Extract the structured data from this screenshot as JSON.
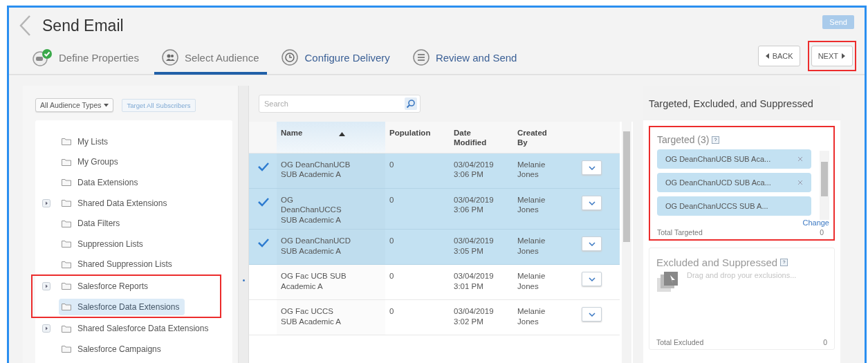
{
  "header": {
    "title": "Send Email",
    "send_button": {
      "label": "Send",
      "disabled": true
    }
  },
  "steps": [
    {
      "label": "Define Properties",
      "selected": false
    },
    {
      "label": "Select Audience",
      "selected": true
    },
    {
      "label": "Configure Delivery",
      "selected": false
    },
    {
      "label": "Review and Send",
      "selected": false
    }
  ],
  "nav_buttons": [
    {
      "label": "BACK",
      "kind": "back",
      "highlighted": false
    },
    {
      "label": "NEXT",
      "kind": "next",
      "highlighted": true
    }
  ],
  "sidebar": {
    "filter": "All Audience Types",
    "target_all": {
      "label": "Target All Subscribers",
      "disabled": true
    },
    "items": [
      {
        "label": "My Lists",
        "expandable": false,
        "selected": false,
        "highlighted": false
      },
      {
        "label": "My Groups",
        "expandable": false,
        "selected": false,
        "highlighted": false
      },
      {
        "label": "Data Extensions",
        "expandable": false,
        "selected": false,
        "highlighted": false
      },
      {
        "label": "Shared Data Extensions",
        "expandable": true,
        "selected": false,
        "highlighted": false
      },
      {
        "label": "Data Filters",
        "expandable": false,
        "selected": false,
        "highlighted": false
      },
      {
        "label": "Suppression Lists",
        "expandable": false,
        "selected": false,
        "highlighted": false
      },
      {
        "label": "Shared Suppression Lists",
        "expandable": false,
        "selected": false,
        "highlighted": false
      },
      {
        "label": "Salesforce Reports",
        "expandable": true,
        "selected": false,
        "highlighted": true
      },
      {
        "label": "Salesforce Data Extensions",
        "expandable": false,
        "selected": true,
        "highlighted": true
      },
      {
        "label": "Shared Salesforce Data Extensions",
        "expandable": true,
        "selected": false,
        "highlighted": false
      },
      {
        "label": "Salesforce Campaigns",
        "expandable": false,
        "selected": false,
        "highlighted": false
      }
    ]
  },
  "search": {
    "placeholder": "Search"
  },
  "table": {
    "columns": [
      {
        "label": "Name",
        "sorted": true
      },
      {
        "label": "Population",
        "sorted": false
      },
      {
        "label": "Date Modified",
        "sorted": false
      },
      {
        "label": "Created By",
        "sorted": false
      }
    ],
    "rows": [
      {
        "selected": true,
        "name": "OG DeanChanUCB SUB Academic A",
        "population": "0",
        "date": "03/04/2019 3:06 PM",
        "created_by": "Melanie Jones"
      },
      {
        "selected": true,
        "name": "OG DeanChanUCCS SUB Academic A",
        "population": "0",
        "date": "03/04/2019 3:06 PM",
        "created_by": "Melanie Jones"
      },
      {
        "selected": true,
        "name": "OG DeanChanUCD SUB Academic A",
        "population": "0",
        "date": "03/04/2019 3:05 PM",
        "created_by": "Melanie Jones"
      },
      {
        "selected": false,
        "name": "OG Fac UCB SUB Academic A",
        "population": "0",
        "date": "03/04/2019 3:01 PM",
        "created_by": "Melanie Jones"
      },
      {
        "selected": false,
        "name": "OG Fac UCCS SUB Academic A",
        "population": "0",
        "date": "03/04/2019 3:02 PM",
        "created_by": "Melanie Jones"
      }
    ]
  },
  "summary": {
    "title": "Targeted, Excluded, and Suppressed",
    "targeted": {
      "heading": "Targeted (3)",
      "highlighted": true,
      "chips": [
        {
          "label": "OG DeanChanUCB SUB Aca...",
          "removable": true
        },
        {
          "label": "OG DeanChanUCD SUB Aca...",
          "removable": true
        },
        {
          "label": "OG DeanChanUCCS SUB A...",
          "removable": false
        }
      ],
      "change_link": "Change",
      "total_label": "Total Targeted",
      "total": "0"
    },
    "excluded": {
      "heading": "Excluded and Suppressed",
      "hint": "Drag and drop your exclusions...",
      "total_label": "Total Excluded",
      "total": "0"
    }
  }
}
